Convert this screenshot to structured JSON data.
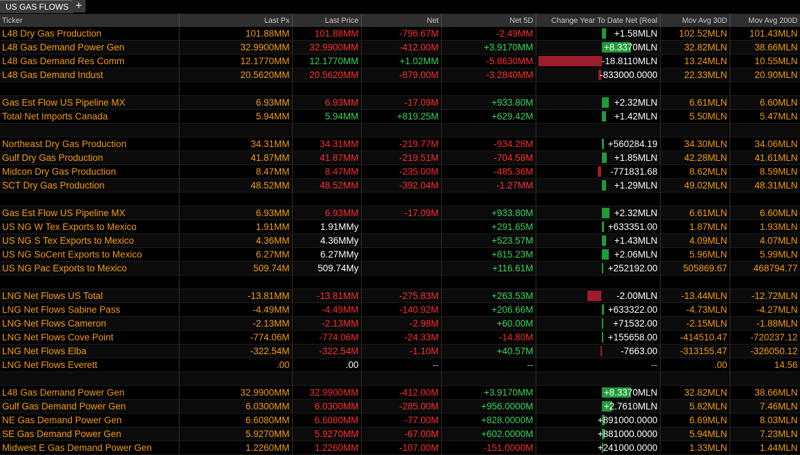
{
  "tab": {
    "label": "US GAS FLOWS",
    "add_label": "+"
  },
  "columns": [
    "Ticker",
    "Last Px",
    "Last Price",
    "Net",
    "Net 5D",
    "Change Year To Date Net (Real",
    "Mov Avg 30D",
    "Mov Avg 200D"
  ],
  "colors": {
    "positive_bar": "#1f9b39",
    "negative_bar": "#9e1d2d",
    "ticker": "#f39c12"
  },
  "rows": [
    {
      "name": "L48 Dry Gas Production",
      "last_px": "101.88MM",
      "last_price": "101.88MM",
      "net": "-796.67M",
      "net5d": "-2.49MM",
      "ytd": "+1.58MLN",
      "ytd_bar": 0.08,
      "ma30": "102.52MLN",
      "ma200": "101.43MLN",
      "lp_color": "red",
      "net_color": "red",
      "n5_color": "red"
    },
    {
      "name": "L48 Gas Demand Power Gen",
      "last_px": "32.9900MM",
      "last_price": "32.9900MM",
      "net": "-412.00M",
      "net5d": "+3.9170MM",
      "ytd": "+8.3370MLN",
      "ytd_bar": 0.5,
      "ma30": "32.82MLN",
      "ma200": "38.66MLN",
      "lp_color": "red",
      "net_color": "red",
      "n5_color": "green"
    },
    {
      "name": "L48 Gas Demand Res Comm",
      "last_px": "12.1770MM",
      "last_price": "12.1770MM",
      "net": "+1.02MM",
      "net5d": "-5.8630MM",
      "ytd": "-18.8110MLN",
      "ytd_bar": -1.0,
      "ma30": "13.24MLN",
      "ma200": "10.55MLN",
      "lp_color": "green",
      "net_color": "green",
      "n5_color": "red"
    },
    {
      "name": "L48 Gas Demand Indust",
      "last_px": "20.5620MM",
      "last_price": "20.5620MM",
      "net": "-879.00M",
      "net5d": "-3.2840MM",
      "ytd": "-833000.0000",
      "ytd_bar": -0.05,
      "ma30": "22.33MLN",
      "ma200": "20.90MLN",
      "lp_color": "red",
      "net_color": "red",
      "n5_color": "red"
    },
    {
      "blank": true
    },
    {
      "name": "Gas Est Flow US Pipeline MX",
      "last_px": "6.93MM",
      "last_price": "6.93MM",
      "net": "-17.09M",
      "net5d": "+933.80M",
      "ytd": "+2.32MLN",
      "ytd_bar": 0.12,
      "ma30": "6.61MLN",
      "ma200": "6.60MLN",
      "lp_color": "red",
      "net_color": "red",
      "n5_color": "green"
    },
    {
      "name": "Total Net Imports Canada",
      "last_px": "5.94MM",
      "last_price": "5.94MM",
      "net": "+819.25M",
      "net5d": "+629.42M",
      "ytd": "+1.42MLN",
      "ytd_bar": 0.08,
      "ma30": "5.50MLN",
      "ma200": "5.47MLN",
      "lp_color": "green",
      "net_color": "green",
      "n5_color": "green"
    },
    {
      "blank": true
    },
    {
      "name": "Northeast Dry Gas Production",
      "last_px": "34.31MM",
      "last_price": "34.31MM",
      "net": "-219.77M",
      "net5d": "-934.28M",
      "ytd": "+560284.19",
      "ytd_bar": 0.04,
      "ma30": "34.30MLN",
      "ma200": "34.06MLN",
      "lp_color": "red",
      "net_color": "red",
      "n5_color": "red"
    },
    {
      "name": "Gulf Dry Gas Production",
      "last_px": "41.87MM",
      "last_price": "41.87MM",
      "net": "-219.51M",
      "net5d": "-704.58M",
      "ytd": "+1.85MLN",
      "ytd_bar": 0.09,
      "ma30": "42.28MLN",
      "ma200": "41.61MLN",
      "lp_color": "red",
      "net_color": "red",
      "n5_color": "red"
    },
    {
      "name": "Midcon Dry Gas Production",
      "last_px": "8.47MM",
      "last_price": "8.47MM",
      "net": "-235.00M",
      "net5d": "-485.36M",
      "ytd": "-771831.68",
      "ytd_bar": -0.06,
      "ma30": "8.62MLN",
      "ma200": "8.59MLN",
      "lp_color": "red",
      "net_color": "red",
      "n5_color": "red"
    },
    {
      "name": "SCT Dry Gas Production",
      "last_px": "48.52MM",
      "last_price": "48.52MM",
      "net": "-392.04M",
      "net5d": "-1.27MM",
      "ytd": "+1.29MLN",
      "ytd_bar": 0.08,
      "ma30": "49.02MLN",
      "ma200": "48.31MLN",
      "lp_color": "red",
      "net_color": "red",
      "n5_color": "red"
    },
    {
      "blank": true
    },
    {
      "name": "Gas Est Flow US Pipeline MX",
      "last_px": "6.93MM",
      "last_price": "6.93MM",
      "net": "-17.09M",
      "net5d": "+933.80M",
      "ytd": "+2.32MLN",
      "ytd_bar": 0.14,
      "ma30": "6.61MLN",
      "ma200": "6.60MLN",
      "lp_color": "red",
      "net_color": "red",
      "n5_color": "green"
    },
    {
      "name": "US NG W Tex Exports to Mexico",
      "last_px": "1.91MM",
      "last_price": "1.91MMy",
      "net": "",
      "net5d": "+291.65M",
      "ytd": "+633351.00",
      "ytd_bar": 0.04,
      "ma30": "1.87MLN",
      "ma200": "1.93MLN",
      "lp_color": "white",
      "net_color": "white",
      "n5_color": "green"
    },
    {
      "name": "US NG S Tex Exports to Mexico",
      "last_px": "4.36MM",
      "last_price": "4.36MMy",
      "net": "",
      "net5d": "+523.57M",
      "ytd": "+1.43MLN",
      "ytd_bar": 0.08,
      "ma30": "4.09MLN",
      "ma200": "4.07MLN",
      "lp_color": "white",
      "net_color": "white",
      "n5_color": "green"
    },
    {
      "name": "US NG SoCent Exports to Mexico",
      "last_px": "6.27MM",
      "last_price": "6.27MMy",
      "net": "",
      "net5d": "+815.23M",
      "ytd": "+2.06MLN",
      "ytd_bar": 0.12,
      "ma30": "5.96MLN",
      "ma200": "5.99MLN",
      "lp_color": "white",
      "net_color": "white",
      "n5_color": "green"
    },
    {
      "name": "US NG Pac Exports to Mexico",
      "last_px": "509.74M",
      "last_price": "509.74My",
      "net": "",
      "net5d": "+116.61M",
      "ytd": "+252192.00",
      "ytd_bar": 0.01,
      "ma30": "505869.67",
      "ma200": "468794.77",
      "lp_color": "white",
      "net_color": "white",
      "n5_color": "green"
    },
    {
      "blank": true
    },
    {
      "name": "LNG Net Flows US Total",
      "last_px": "-13.81MM",
      "last_price": "-13.81MM",
      "net": "-275.83M",
      "net5d": "+263.53M",
      "ytd": "-2.00MLN",
      "ytd_bar": -0.22,
      "ma30": "-13.44MLN",
      "ma200": "-12.72MLN",
      "lp_color": "red",
      "net_color": "red",
      "n5_color": "green"
    },
    {
      "name": "LNG Net Flows Sabine Pass",
      "last_px": "-4.49MM",
      "last_price": "-4.49MM",
      "net": "-140.92M",
      "net5d": "+206.66M",
      "ytd": "+633322.00",
      "ytd_bar": 0.04,
      "ma30": "-4.73MLN",
      "ma200": "-4.27MLN",
      "lp_color": "red",
      "net_color": "red",
      "n5_color": "green"
    },
    {
      "name": "LNG Net Flows Cameron",
      "last_px": "-2.13MM",
      "last_price": "-2.13MM",
      "net": "-2.98M",
      "net5d": "+60.00M",
      "ytd": "+71532.00",
      "ytd_bar": 0.01,
      "ma30": "-2.15MLN",
      "ma200": "-1.88MLN",
      "lp_color": "red",
      "net_color": "red",
      "n5_color": "green"
    },
    {
      "name": "LNG Net Flows Cove Point",
      "last_px": "-774.06M",
      "last_price": "-774.06M",
      "net": "-24.33M",
      "net5d": "-14.80M",
      "ytd": "+155658.00",
      "ytd_bar": 0.01,
      "ma30": "-414510.47",
      "ma200": "-720237.12",
      "lp_color": "red",
      "net_color": "red",
      "n5_color": "red"
    },
    {
      "name": "LNG Net Flows Elba",
      "last_px": "-322.54M",
      "last_price": "-322.54M",
      "net": "-1.10M",
      "net5d": "+40.57M",
      "ytd": "-7663.00",
      "ytd_bar": -0.005,
      "ma30": "-313155.47",
      "ma200": "-326050.12",
      "lp_color": "red",
      "net_color": "red",
      "n5_color": "green"
    },
    {
      "name": "LNG Net Flows Everett",
      "last_px": ".00",
      "last_price": ".00",
      "net": "--",
      "net5d": "--",
      "ytd": "--",
      "ytd_bar": 0,
      "ma30": ".00",
      "ma200": "14.56",
      "lp_color": "white",
      "net_color": "gray",
      "n5_color": "gray",
      "ytd_color": "gray"
    },
    {
      "blank": true
    },
    {
      "name": "L48 Gas Demand Power Gen",
      "last_px": "32.9900MM",
      "last_price": "32.9900MM",
      "net": "-412.00M",
      "net5d": "+3.9170MM",
      "ytd": "+8.3370MLN",
      "ytd_bar": 0.5,
      "ma30": "32.82MLN",
      "ma200": "38.66MLN",
      "lp_color": "red",
      "net_color": "red",
      "n5_color": "green"
    },
    {
      "name": "Gulf Gas Demand Power Gen",
      "last_px": "6.0300MM",
      "last_price": "6.0300MM",
      "net": "-285.00M",
      "net5d": "+956.0000M",
      "ytd": "+2.7610MLN",
      "ytd_bar": 0.18,
      "ma30": "5.82MLN",
      "ma200": "7.46MLN",
      "lp_color": "red",
      "net_color": "red",
      "n5_color": "green"
    },
    {
      "name": "NE Gas Demand Power Gen",
      "last_px": "6.6080MM",
      "last_price": "6.6080MM",
      "net": "-77.00M",
      "net5d": "+828.0000M",
      "ytd": "+891000.0000",
      "ytd_bar": 0.05,
      "ma30": "6.69MLN",
      "ma200": "8.03MLN",
      "lp_color": "red",
      "net_color": "red",
      "n5_color": "green"
    },
    {
      "name": "SE Gas Demand Power Gen",
      "last_px": "5.9270MM",
      "last_price": "5.9270MM",
      "net": "-67.00M",
      "net5d": "+602.0000M",
      "ytd": "+881000.0000",
      "ytd_bar": 0.05,
      "ma30": "5.94MLN",
      "ma200": "7.23MLN",
      "lp_color": "red",
      "net_color": "red",
      "n5_color": "green"
    },
    {
      "name": "Midwest E Gas Demand Power Gen",
      "last_px": "1.2260MM",
      "last_price": "1.2260MM",
      "net": "-107.00M",
      "net5d": "-151.0000M",
      "ytd": "+241000.0000",
      "ytd_bar": 0.015,
      "ma30": "1.33MLN",
      "ma200": "1.44MLN",
      "lp_color": "red",
      "net_color": "red",
      "n5_color": "red"
    }
  ]
}
